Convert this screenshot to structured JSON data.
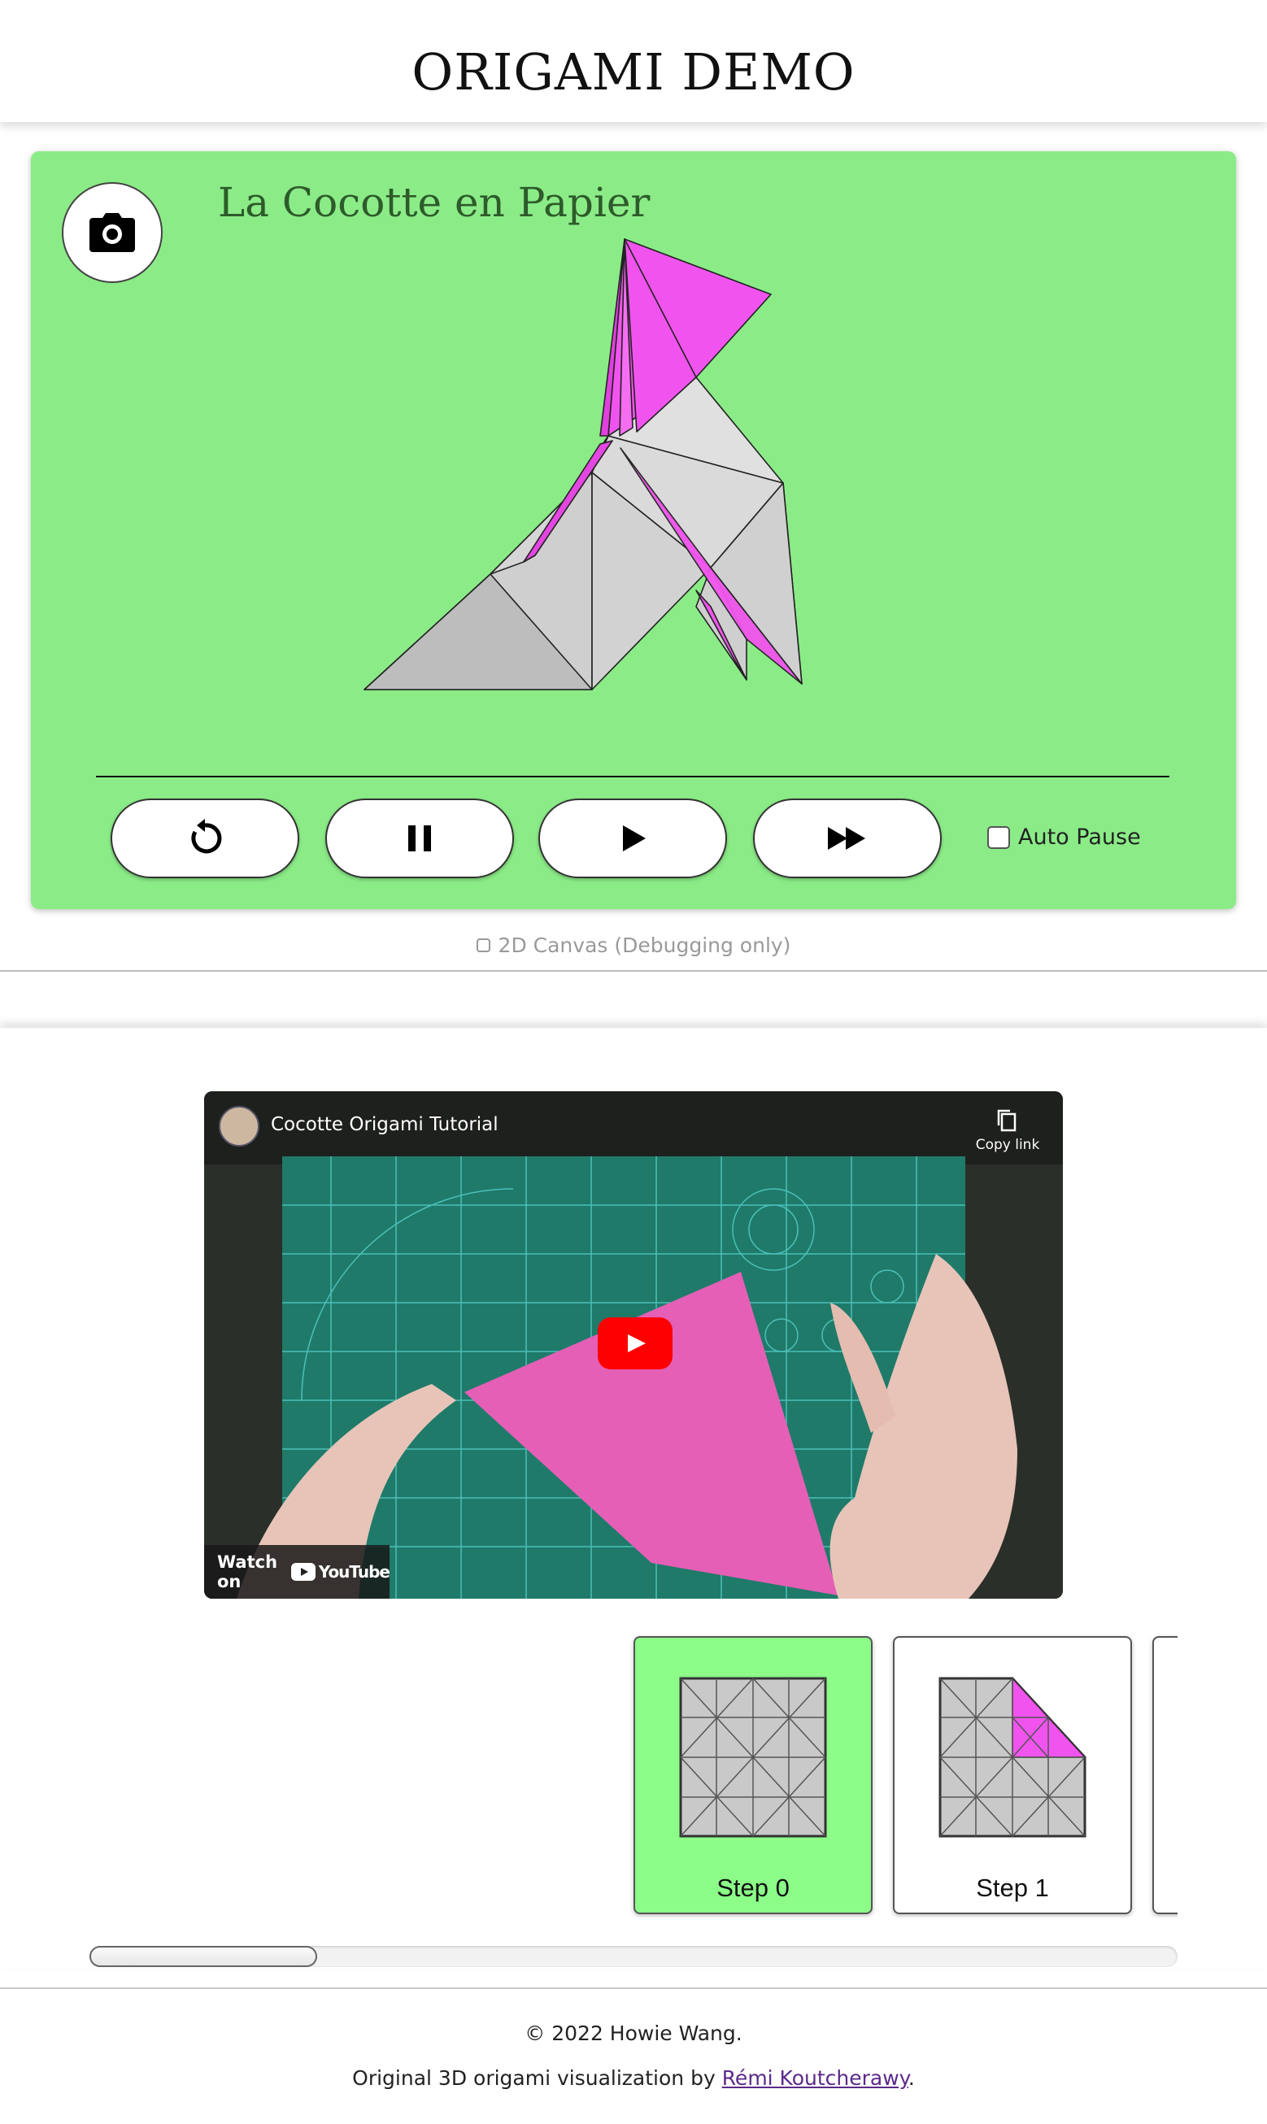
{
  "header": {
    "title": "ORIGAMI DEMO"
  },
  "viewer": {
    "model_title": "La Cocotte en Papier",
    "camera_icon": "camera-icon",
    "controls": [
      {
        "name": "restart-button",
        "icon": "restart-icon"
      },
      {
        "name": "pause-button",
        "icon": "pause-icon"
      },
      {
        "name": "play-button",
        "icon": "play-icon"
      },
      {
        "name": "fast-forward-button",
        "icon": "fast-forward-icon"
      }
    ],
    "auto_pause_label": "Auto Pause",
    "auto_pause_checked": false
  },
  "debug": {
    "label": "2D Canvas (Debugging only)",
    "checked": false
  },
  "video": {
    "title": "Cocotte Origami Tutorial",
    "copy_link_label": "Copy link",
    "watch_on_label": "Watch on",
    "youtube_label": "YouTube"
  },
  "steps": [
    {
      "label": "Step 0",
      "active": true
    },
    {
      "label": "Step 1",
      "active": false
    }
  ],
  "colors": {
    "stage": "#8bec87",
    "paper_front": "#f154ee",
    "paper_back": "#d9d9d9",
    "active_step": "#8bfd88"
  },
  "footer": {
    "copyright": "© 2022 Howie Wang.",
    "credit_prefix": "Original 3D origami visualization by ",
    "credit_link": "Rémi Koutcherawy",
    "credit_suffix": "."
  }
}
